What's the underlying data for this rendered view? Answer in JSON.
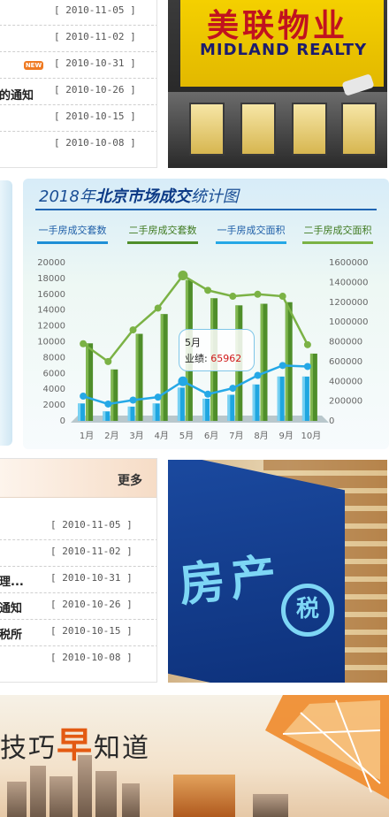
{
  "news_top": {
    "items": [
      {
        "title": "",
        "date": "[ 2010-11-05 ]",
        "new": false
      },
      {
        "title": "",
        "date": "[ 2010-11-02 ]",
        "new": false
      },
      {
        "title": "",
        "date": "[ 2010-10-31 ]",
        "new": true,
        "badge": "NEW"
      },
      {
        "title": "的通知",
        "date": "[ 2010-10-26 ]",
        "new": false
      },
      {
        "title": "",
        "date": "[ 2010-10-15 ]",
        "new": false
      },
      {
        "title": "",
        "date": "[ 2010-10-08 ]",
        "new": false
      }
    ]
  },
  "photo_midland": {
    "sign_cn": "美联物业",
    "sign_en": "MIDLAND REALTY"
  },
  "chart": {
    "title_prefix": "2018年",
    "title_bold": "北京市场成交",
    "title_suffix": "统计图",
    "legend_tabs": [
      "一手房成交套数",
      "二手房成交套数",
      "一手房成交面积",
      "二手房成交面积"
    ],
    "tooltip_month": "5月",
    "tooltip_label": "业绩:",
    "tooltip_value": "65962"
  },
  "chart_data": {
    "type": "bar",
    "categories": [
      "1月",
      "2月",
      "3月",
      "4月",
      "5月",
      "6月",
      "7月",
      "8月",
      "9月",
      "10月"
    ],
    "title": "2018年北京市场成交统计图",
    "ylim_left": [
      0,
      20000
    ],
    "ylim_right": [
      0,
      1600000
    ],
    "left_ticks": [
      0,
      2000,
      4000,
      6000,
      8000,
      10000,
      12000,
      14000,
      16000,
      18000,
      20000
    ],
    "right_ticks": [
      0,
      200000,
      400000,
      600000,
      800000,
      1000000,
      1200000,
      1400000,
      1600000
    ],
    "series": [
      {
        "name": "一手房成交套数",
        "kind": "bar",
        "axis": "left",
        "color": "#1fa6e0",
        "values": [
          2200,
          1200,
          1800,
          2200,
          4200,
          2800,
          3300,
          4600,
          5600,
          5600
        ]
      },
      {
        "name": "二手房成交套数",
        "kind": "bar",
        "axis": "left",
        "color": "#4f8e2a",
        "values": [
          9800,
          6500,
          11000,
          13500,
          17800,
          15500,
          14600,
          14800,
          15000,
          8500
        ]
      },
      {
        "name": "一手房成交面积",
        "kind": "line",
        "axis": "right",
        "color": "#25a8e6",
        "values": [
          250000,
          170000,
          210000,
          240000,
          400000,
          270000,
          330000,
          460000,
          560000,
          550000
        ]
      },
      {
        "name": "二手房成交面积",
        "kind": "line",
        "axis": "right",
        "color": "#7bb245",
        "values": [
          780000,
          600000,
          920000,
          1140000,
          1470000,
          1320000,
          1260000,
          1280000,
          1260000,
          770000
        ]
      }
    ]
  },
  "news_bottom": {
    "more": "更多",
    "items": [
      {
        "title": "",
        "date": "[ 2010-11-05 ]"
      },
      {
        "title": "",
        "date": "[ 2010-11-02 ]"
      },
      {
        "title": "理...",
        "date": "[ 2010-10-31 ]"
      },
      {
        "title": "通知",
        "date": "[ 2010-10-26 ]"
      },
      {
        "title": "税所",
        "date": "[ 2010-10-15 ]"
      },
      {
        "title": "",
        "date": "[ 2010-10-08 ]"
      }
    ]
  },
  "photo_tax": {
    "text": "房产",
    "circle": "税"
  },
  "banner": {
    "part1": "技巧",
    "highlight": "早",
    "part2": "知道"
  }
}
